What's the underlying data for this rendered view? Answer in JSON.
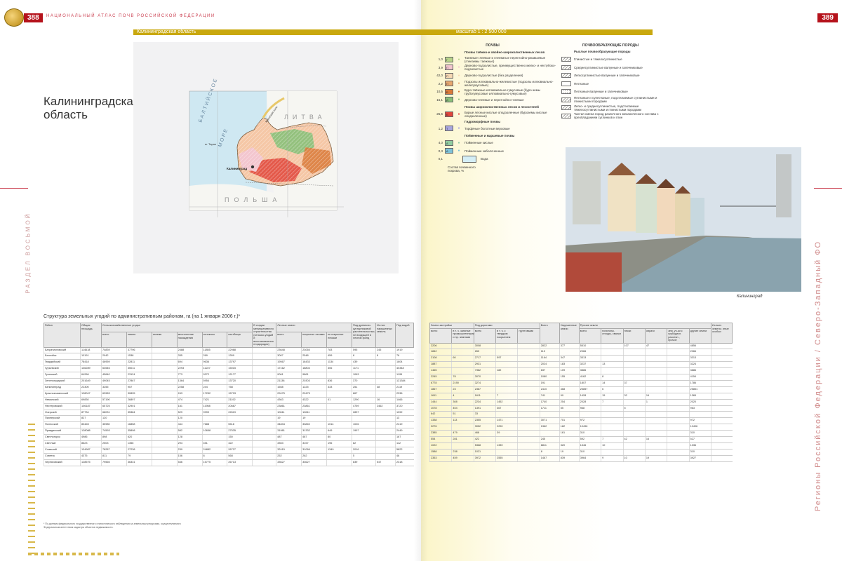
{
  "header": {
    "page_left": "388",
    "page_right": "389",
    "running_head": "НАЦИОНАЛЬНЫЙ АТЛАС ПОЧВ РОССИЙСКОЙ ФЕДЕРАЦИИ"
  },
  "map_bar": {
    "region": "Калининградская область",
    "scale": "масштаб 1 : 2 500 000"
  },
  "title": {
    "line1": "Калининградская",
    "line2": "область"
  },
  "map_labels": {
    "baltic": "БАЛТИЙСКОЕ",
    "sea": "МОРЕ",
    "litva": "ЛИТВА",
    "polsha": "ПОЛЬША",
    "city": "Калининград",
    "cape": "м. Таран",
    "spit": "Куршская коса"
  },
  "soil_legend": {
    "title": "ПОЧВЫ",
    "groups": [
      {
        "heading": "Почвы таёжно-и хвойно-широколиственных лесов",
        "rows": [
          {
            "pct": "1,0",
            "code": "Г",
            "color": "#b8d48a",
            "text": "Таежные глеевые и глееватые перегнойно-ржавыевые (глееземы таежные)"
          },
          {
            "pct": "3,9",
            "code": "П",
            "color": "#f3c6cf",
            "text": "Дерново-подзолистые, преимущественно мелко- и неглубоко-подзолистые"
          },
          {
            "pct": "42,0",
            "code": "П",
            "color": "#f7d9b3",
            "text": "Дерново-подзолистые (без разделения)"
          },
          {
            "pct": "2,2",
            "code": "П",
            "color": "#e8a86f",
            "text": "Подзолы иллювиально-железистые (подзолы иллювиально-желегумусовые)"
          },
          {
            "pct": "10,5",
            "code": "Б",
            "color": "#d97a3a",
            "text": "Буро-таёжные иллювиально-гумусовые (буро-земы грубогумусовые иллювиально-гумусовые)"
          },
          {
            "pct": "16,1",
            "code": "Д",
            "color": "#8ac07a",
            "text": "Дерново-глеевые и перегнойно-глеевые"
          }
        ]
      },
      {
        "heading": "Почвы широколиственных лесов и лесостепей",
        "rows": [
          {
            "pct": "25,6",
            "code": "Б",
            "color": "#e0463b",
            "text": "Бурые лесные кислые оподзоленные (буроземы кислые оподзоленные)"
          }
        ]
      },
      {
        "heading": "Гидроморфные почвы",
        "rows": [
          {
            "pct": "1,2",
            "code": "Т",
            "color": "#a9a7df",
            "text": "Торфяные болотные верховые"
          }
        ]
      },
      {
        "heading": "Пойменные и маршевые почвы",
        "rows": [
          {
            "pct": "4,0",
            "code": "А",
            "color": "#8fcc9f",
            "text": "Пойменные кислые"
          },
          {
            "pct": "0,3",
            "code": "А",
            "color": "#7ec3d9",
            "text": "Пойменные заболоченные"
          }
        ]
      }
    ],
    "water": {
      "pct": "0,1",
      "text": "Вода"
    },
    "cover_note": "Состав почвенного покрова, %"
  },
  "rock_legend": {
    "title": "ПОЧВООБРАЗУЮЩИЕ ПОРОДЫ",
    "subtitle": "Рыхлые почвообразующие породы",
    "rows": [
      {
        "pat": "hatch",
        "text": "Глинистые и тяжелосуглинистые"
      },
      {
        "pat": "hatch",
        "text": "Среднесуглинистые валунные и галечниковые"
      },
      {
        "pat": "hatch",
        "text": "Легкосуглинистые валунные и галечниковые"
      },
      {
        "pat": "none",
        "text": "Песчаные"
      },
      {
        "pat": "dot",
        "text": "Песчаные валунные и галечниковые"
      },
      {
        "pat": "hatch",
        "text": "Песчаные и супесчаные, подстилаемые суглинистыми и глинистыми породами"
      },
      {
        "pat": "hatch",
        "text": "Легко- и среднесуглинистые, подстилаемые тяжелосуглинистыми и глинистыми породами"
      },
      {
        "pat": "hatch",
        "text": "Частая смена пород различного механического состава с преобладанием суглинков и глин"
      }
    ]
  },
  "photo": {
    "caption": "Калининград"
  },
  "side": {
    "left": "РАЗДЕЛ ВОСЬМОЙ",
    "right": "Регионы Российской Федерации / Северо-Западный ФО"
  },
  "table": {
    "title": "Структура земельных угодий по административным районам, га (на 1 января 2006 г.)*",
    "left_headers": [
      "Район",
      "Общая площадь",
      "всего",
      "пашня",
      "залежь",
      "многолетние насаждения",
      "сенокосы",
      "пастбища",
      "В стадии мелиоративного строительства (сельско-угодий и восстановления плодородия)",
      "всего",
      "покрытые лесами",
      "не покрытые лесами",
      "Под древесно-кустарниковой растительностью, не входящей в лесной фонд",
      "Из них нарушенных земель",
      "Под водой"
    ],
    "left_group_a": "Сельскохозяйственные угодья",
    "left_group_a_sub": "в том числе",
    "left_group_b": "Лесные земли",
    "left_group_b_sub": "в том числе",
    "right_headers": [
      "всего",
      "в т. ч. занятые промышленными и пр. землями",
      "всего",
      "в т. ч. с твердым покрытием",
      "грунтовыми",
      "Всего",
      "Нарушенные земли",
      "всего",
      "полигоны, отходы, свалки",
      "пески",
      "овраги",
      "зем. уч-ки с грубодисп. рассеян., прочие",
      "другие земли",
      "Из всех земель: иные особых"
    ],
    "right_group_a": "Земли застройки",
    "right_group_b": "Под дорогами",
    "right_group_c": "Прочие земли",
    "right_group_c_sub": "в том числе",
    "rows_left": [
      [
        "Багратионовский",
        "114618",
        "74839",
        "37796",
        "",
        "2488",
        "11855",
        "22988",
        "",
        "23648",
        "23065",
        "783",
        "595",
        "245",
        "1919"
      ],
      [
        "Балтийск",
        "10191",
        "2942",
        "1538",
        "",
        "335",
        "269",
        "1309",
        "",
        "3007",
        "2548",
        "459",
        "8",
        "8",
        "76"
      ],
      [
        "Гвардейский",
        "78418",
        "46959",
        "22811",
        "",
        "694",
        "9636",
        "13797",
        "",
        "19567",
        "18433",
        "1134",
        "439",
        "",
        "1604"
      ],
      [
        "Гурьевский",
        "136289",
        "63546",
        "35011",
        "",
        "2293",
        "11227",
        "15015",
        "",
        "17162",
        "18804",
        "306",
        "1171",
        "",
        "40348"
      ],
      [
        "Гусевский",
        "64266",
        "45640",
        "23124",
        "",
        "773",
        "9372",
        "12177",
        "",
        "9061",
        "9861",
        "",
        "1063",
        "",
        "1195"
      ],
      [
        "Зеленоградский",
        "201649",
        "49045",
        "27867",
        "",
        "1364",
        "5954",
        "13720",
        "",
        "21138",
        "20303",
        "836",
        "370",
        "",
        "121384"
      ],
      [
        "Калининград",
        "22300",
        "3255",
        "957",
        "",
        "2258",
        "244",
        "758",
        "",
        "1558",
        "1225",
        "333",
        "251",
        "48",
        "2119"
      ],
      [
        "Краснознаменский",
        "128047",
        "63983",
        "30895",
        "",
        "243",
        "17252",
        "15793",
        "",
        "29475",
        "29475",
        "",
        "867",
        "",
        "2336"
      ],
      [
        "Неманский",
        "69830",
        "57190",
        "26897",
        "",
        "474",
        "7421",
        "21192",
        "",
        "4363",
        "4322",
        "41",
        "1290",
        "16",
        "1466"
      ],
      [
        "Нестеровский",
        "106187",
        "65725",
        "32901",
        "",
        "181",
        "11958",
        "20687",
        "",
        "23861",
        "23861",
        "",
        "4759",
        "2462",
        "3720"
      ],
      [
        "Озерский",
        "87734",
        "68031",
        "35384",
        "",
        "529",
        "9999",
        "22619",
        "",
        "10611",
        "10611",
        "",
        "2837",
        "",
        "1392"
      ],
      [
        "Пионерский",
        "827",
        "120",
        "",
        "",
        "120",
        "",
        "",
        "",
        "19",
        "19",
        "",
        "",
        "",
        "13"
      ],
      [
        "Полесский",
        "83428",
        "35980",
        "16858",
        "",
        "444",
        "7688",
        "5518",
        "",
        "34834",
        "33840",
        "1014",
        "1026",
        "",
        "2419"
      ],
      [
        "Правдинский",
        "128088",
        "74593",
        "35898",
        "",
        "582",
        "10658",
        "27535",
        "",
        "31981",
        "31332",
        "649",
        "1997",
        "",
        "2449"
      ],
      [
        "Светлогорск",
        "4986",
        "898",
        "620",
        "",
        "128",
        "",
        "150",
        "",
        "487",
        "487",
        "80",
        "",
        "",
        "167"
      ],
      [
        "Светлый",
        "8623",
        "2503",
        "1356",
        "",
        "294",
        "451",
        "322",
        "",
        "3353",
        "3157",
        "196",
        "82",
        "",
        "112"
      ],
      [
        "Славский",
        "134987",
        "78287",
        "27238",
        "",
        "239",
        "24882",
        "26727",
        "",
        "32415",
        "31066",
        "1349",
        "2016",
        "",
        "5822"
      ],
      [
        "Советск",
        "4375",
        "811",
        "79",
        "",
        "156",
        "8",
        "568",
        "",
        "252",
        "262",
        "",
        "5",
        "",
        "48"
      ],
      [
        "Черняховский",
        "128575",
        "79565",
        "36331",
        "",
        "546",
        "15775",
        "26713",
        "",
        "33627",
        "33627",
        "",
        "839",
        "547",
        "2318"
      ]
    ],
    "rows_right": [
      [
        "2206",
        "",
        "3008",
        "",
        "",
        "2822",
        "377",
        "5510",
        "",
        "107",
        "47",
        "",
        "4856",
        ""
      ],
      [
        "1842",
        "",
        "263",
        "",
        "",
        "113",
        "",
        "2066",
        "",
        "",
        "",
        "",
        "2066",
        ""
      ],
      [
        "2108",
        "60",
        "2717",
        "597",
        "",
        "1164",
        "347",
        "3313",
        "",
        "",
        "",
        "",
        "3313",
        ""
      ],
      [
        "1887",
        "",
        "2931",
        "",
        "",
        "2024",
        "183",
        "3237",
        "13",
        "",
        "",
        "",
        "3224",
        ""
      ],
      [
        "1465",
        "",
        "7382",
        "182",
        "",
        "837",
        "109",
        "3886",
        "",
        "",
        "",
        "",
        "3886",
        ""
      ],
      [
        "2245",
        "78",
        "3070",
        "",
        "",
        "1080",
        "155",
        "4162",
        "8",
        "",
        "",
        "",
        "4154",
        ""
      ],
      [
        "6778",
        "2190",
        "3274",
        "",
        "",
        "191",
        "",
        "1807",
        "14",
        "37",
        "",
        "",
        "1786",
        ""
      ],
      [
        "1867",
        "23",
        "2387",
        "",
        "",
        "2410",
        "468",
        "25857",
        "6",
        "",
        "",
        "",
        "25851",
        ""
      ],
      [
        "1611",
        "4",
        "1611",
        "7",
        "",
        "741",
        "99",
        "1428",
        "15",
        "32",
        "16",
        "",
        "1365",
        ""
      ],
      [
        "1444",
        "308",
        "2234",
        "1452",
        "",
        "1740",
        "254",
        "2028",
        "7",
        "",
        "1",
        "",
        "2020",
        ""
      ],
      [
        "1078",
        "404",
        "1391",
        "367",
        "",
        "1711",
        "55",
        "968",
        "",
        "5",
        "",
        "",
        "963",
        ""
      ],
      [
        "642",
        "51",
        "33",
        "",
        "",
        "",
        "",
        "",
        "",
        "",
        "",
        "",
        "",
        ""
      ],
      [
        "1338",
        "113",
        "2355",
        "1471",
        "",
        "3071",
        "701",
        "972",
        "",
        "",
        "",
        "",
        "972",
        ""
      ],
      [
        "2276",
        "",
        "3052",
        "2290",
        "",
        "1362",
        "182",
        "10496",
        "",
        "",
        "",
        "",
        "10496",
        ""
      ],
      [
        "2385",
        "479",
        "468",
        "39",
        "",
        "",
        "161",
        "310",
        "",
        "",
        "",
        "",
        "310",
        ""
      ],
      [
        "554",
        "281",
        "422",
        "",
        "",
        "245",
        "",
        "592",
        "7",
        "42",
        "16",
        "",
        "527",
        ""
      ],
      [
        "1022",
        "",
        "5368",
        "1339",
        "",
        "8811",
        "320",
        "1346",
        "10",
        "",
        "",
        "",
        "1336",
        ""
      ],
      [
        "1588",
        "238",
        "1021",
        "",
        "",
        "8",
        "19",
        "310",
        "",
        "",
        "",
        "",
        "310",
        ""
      ],
      [
        "2353",
        "459",
        "3972",
        "2555",
        "",
        "1467",
        "839",
        "3964",
        "9",
        "10",
        "19",
        "",
        "3927",
        ""
      ]
    ],
    "note": "* По данным федерального государственного статистического наблюдения за земельным ресурсами, осуществляемого Федеральным агентством кадастра объектов недвижимости."
  }
}
